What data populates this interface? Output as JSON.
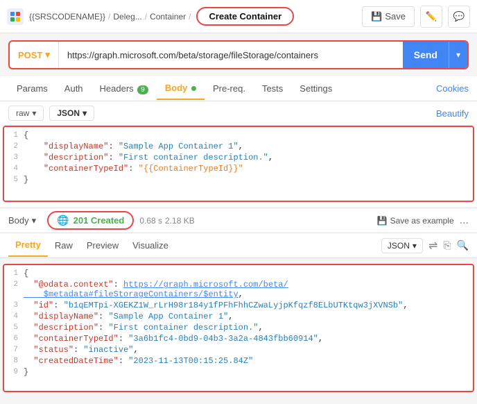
{
  "header": {
    "logo_label": "{{SRSCODENAME}}",
    "breadcrumb": [
      "Deleg...",
      "/",
      "Container",
      "/"
    ],
    "active_tab": "Create Container",
    "save_label": "Save",
    "edit_icon": "✏",
    "comment_icon": "💬"
  },
  "url_bar": {
    "method": "POST",
    "url": "https://graph.microsoft.com/beta/storage/fileStorage/containers",
    "send_label": "Send"
  },
  "request_tabs": {
    "tabs": [
      "Params",
      "Auth",
      "Headers",
      "Body",
      "Pre-req.",
      "Tests",
      "Settings"
    ],
    "active": "Body",
    "headers_count": "9",
    "body_dot": true,
    "cookies_label": "Cookies"
  },
  "body_editor": {
    "format": "raw",
    "format_type": "JSON",
    "beautify_label": "Beautify",
    "code": [
      {
        "line": 1,
        "content": "{"
      },
      {
        "line": 2,
        "content": "    \"displayName\": \"Sample App Container 1\","
      },
      {
        "line": 3,
        "content": "    \"description\": \"First container description.\","
      },
      {
        "line": 4,
        "content": "    \"containerTypeId\": \"{{ContainerTypeId}}\""
      },
      {
        "line": 5,
        "content": "}"
      }
    ]
  },
  "response_bar": {
    "body_label": "Body",
    "status_code": "201 Created",
    "timing": "0.68 s",
    "size": "2.18 KB",
    "save_example_label": "Save as example",
    "more": "..."
  },
  "response_tabs": {
    "tabs": [
      "Pretty",
      "Raw",
      "Preview",
      "Visualize"
    ],
    "active": "Pretty",
    "format": "JSON",
    "filter_icon": "⇌",
    "copy_icon": "⎘",
    "search_icon": "🔍"
  },
  "response_code": {
    "lines": [
      {
        "line": 1,
        "content": "{"
      },
      {
        "line": 2,
        "key": "\"@odata.context\"",
        "value_link": "https://graph.microsoft.com/beta/$metadata#fileStorageContainers/$entity",
        "value_link_display": "https://graph.microsoft.com/beta/\n  $metadata#fileStorageContainers/$entity"
      },
      {
        "line": 3,
        "key": "\"id\"",
        "value": "\"b1qEMTpi-XGEKZ1W_rLrH98r184y1fPFhFhhCZwaLyjpKfqzf8ELbUTKtqw3jXVNSb\""
      },
      {
        "line": 4,
        "key": "\"displayName\"",
        "value": "\"Sample App Container 1\""
      },
      {
        "line": 5,
        "key": "\"description\"",
        "value": "\"First container description.\""
      },
      {
        "line": 6,
        "key": "\"containerTypeId\"",
        "value": "\"3a6b1fc4-0bd9-04b3-3a2a-4843fbb60914\""
      },
      {
        "line": 7,
        "key": "\"status\"",
        "value": "\"inactive\""
      },
      {
        "line": 8,
        "key": "\"createdDateTime\"",
        "value": "\"2023-11-13T00:15:25.84Z\""
      },
      {
        "line": 9,
        "content": "}"
      }
    ]
  }
}
